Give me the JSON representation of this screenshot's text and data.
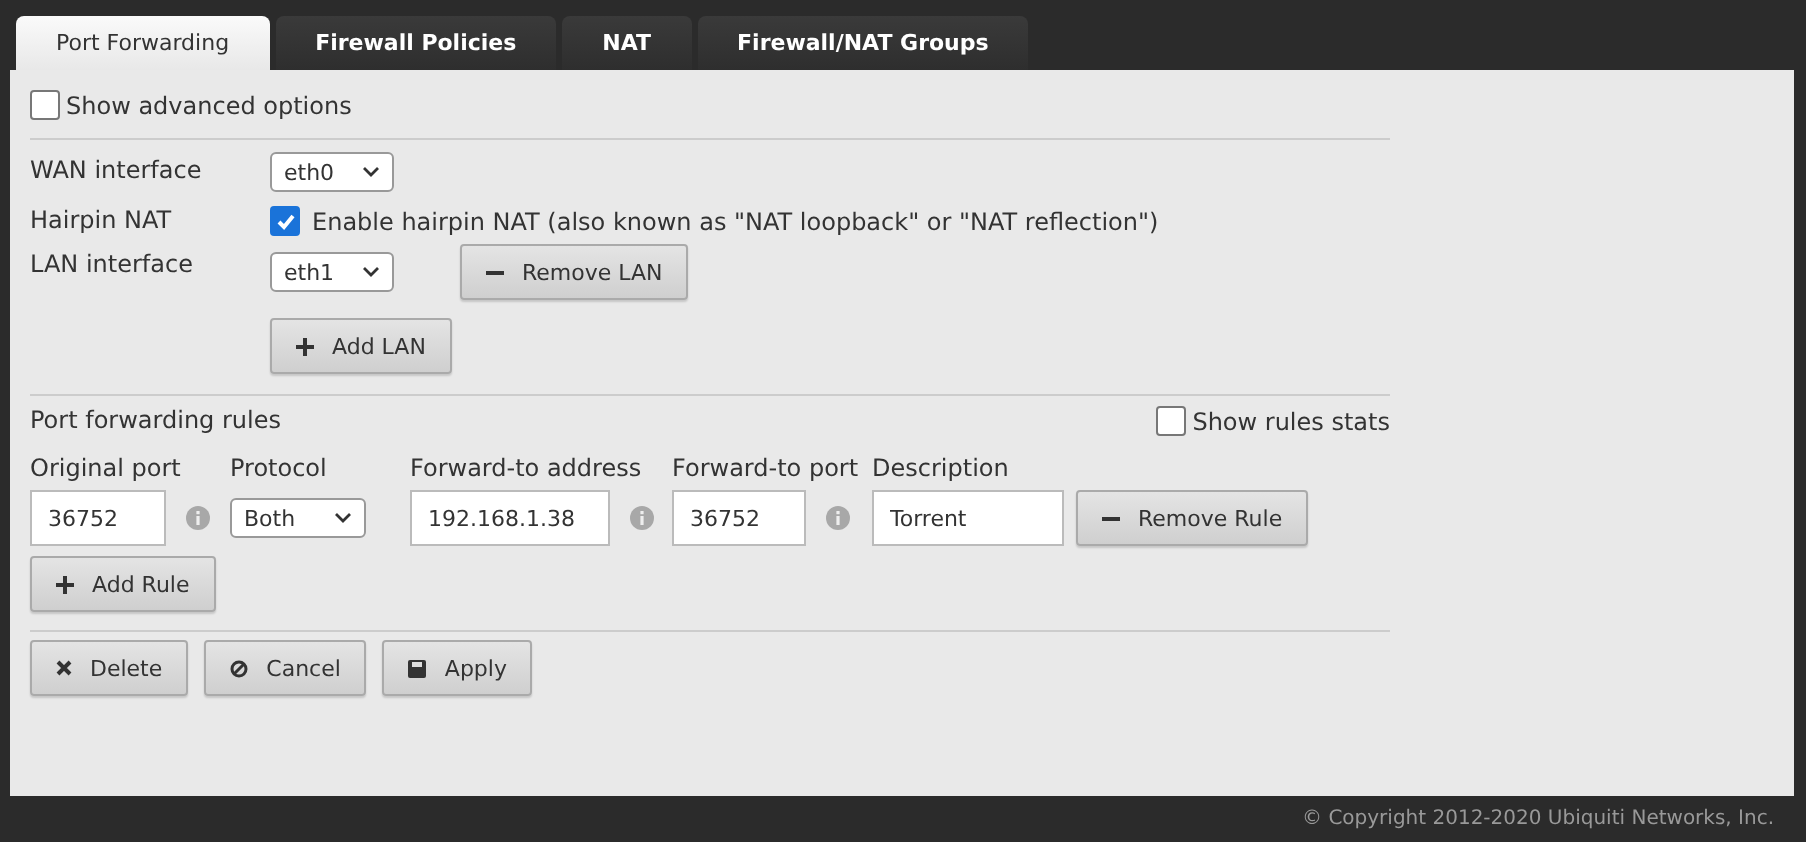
{
  "tabs": [
    {
      "label": "Port Forwarding",
      "selected": true
    },
    {
      "label": "Firewall Policies",
      "selected": false
    },
    {
      "label": "NAT",
      "selected": false
    },
    {
      "label": "Firewall/NAT Groups",
      "selected": false
    }
  ],
  "advanced_options": {
    "label": "Show advanced options",
    "checked": false
  },
  "wan_interface": {
    "label": "WAN interface",
    "value": "eth0"
  },
  "hairpin_nat": {
    "label": "Hairpin NAT",
    "checkbox_label": "Enable hairpin NAT (also known as \"NAT loopback\" or \"NAT reflection\")",
    "checked": true
  },
  "lan_interface": {
    "label": "LAN interface",
    "value": "eth1",
    "remove_button": "Remove LAN"
  },
  "add_lan_button": "Add LAN",
  "rules": {
    "title": "Port forwarding rules",
    "stats": {
      "label": "Show rules stats",
      "checked": false
    },
    "columns": [
      "Original port",
      "Protocol",
      "Forward-to address",
      "Forward-to port",
      "Description"
    ],
    "rows": [
      {
        "original_port": "36752",
        "protocol": "Both",
        "address": "192.168.1.38",
        "forward_port": "36752",
        "description": "Torrent",
        "remove_button": "Remove Rule"
      }
    ],
    "add_button": "Add Rule"
  },
  "actions": [
    {
      "label": "Delete",
      "kind": "delete"
    },
    {
      "label": "Cancel",
      "kind": "cancel"
    },
    {
      "label": "Apply",
      "kind": "apply"
    }
  ],
  "footer": "© Copyright 2012-2020 Ubiquiti Networks, Inc."
}
